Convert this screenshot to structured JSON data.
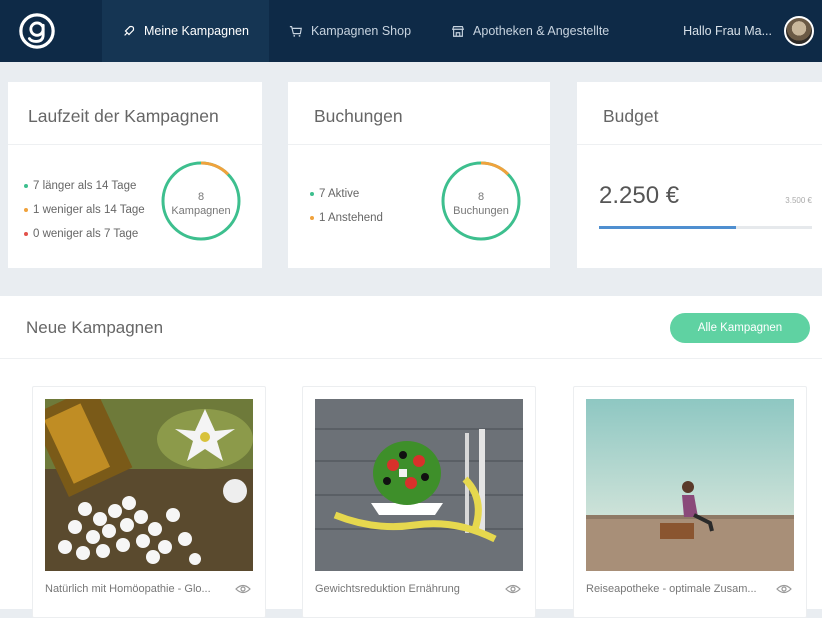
{
  "header": {
    "logo_icon": "at-logo-icon",
    "nav": [
      {
        "label": "Meine Kampagnen",
        "icon": "rocket-icon",
        "active": true
      },
      {
        "label": "Kampagnen Shop",
        "icon": "cart-icon",
        "active": false
      },
      {
        "label": "Apotheken & Angestellte",
        "icon": "store-icon",
        "active": false
      }
    ],
    "greeting": "Hallo Frau Ma..."
  },
  "laufzeit": {
    "title": "Laufzeit der Kampagnen",
    "items": [
      {
        "text": "7 länger als 14 Tage",
        "color": "#3dbf8e"
      },
      {
        "text": "1 weniger als 14 Tage",
        "color": "#f0a23c"
      },
      {
        "text": "0 weniger als 7 Tage",
        "color": "#e2514b"
      }
    ],
    "ring_count": "8",
    "ring_label": "Kampagnen",
    "ring_fraction_orange": 0.125
  },
  "buchungen": {
    "title": "Buchungen",
    "items": [
      {
        "text": "7 Aktive",
        "color": "#3dbf8e"
      },
      {
        "text": "1 Anstehend",
        "color": "#f0a23c"
      }
    ],
    "ring_count": "8",
    "ring_label": "Buchungen",
    "ring_fraction_orange": 0.125
  },
  "budget": {
    "title": "Budget",
    "value": "2.250 €",
    "max": "3.500 €",
    "fill_fraction": 0.643
  },
  "neue_kampagnen": {
    "title": "Neue Kampagnen",
    "button": "Alle Kampagnen",
    "cards": [
      {
        "label": "Natürlich mit Homöopathie - Glo..."
      },
      {
        "label": "Gewichtsreduktion Ernährung"
      },
      {
        "label": "Reiseapotheke - optimale Zusam..."
      }
    ]
  },
  "colors": {
    "navy": "#0e2a47",
    "green": "#3dbf8e",
    "orange": "#f0a23c",
    "red": "#e2514b",
    "blue": "#4f8fd0",
    "button_green": "#5fd2a2"
  }
}
